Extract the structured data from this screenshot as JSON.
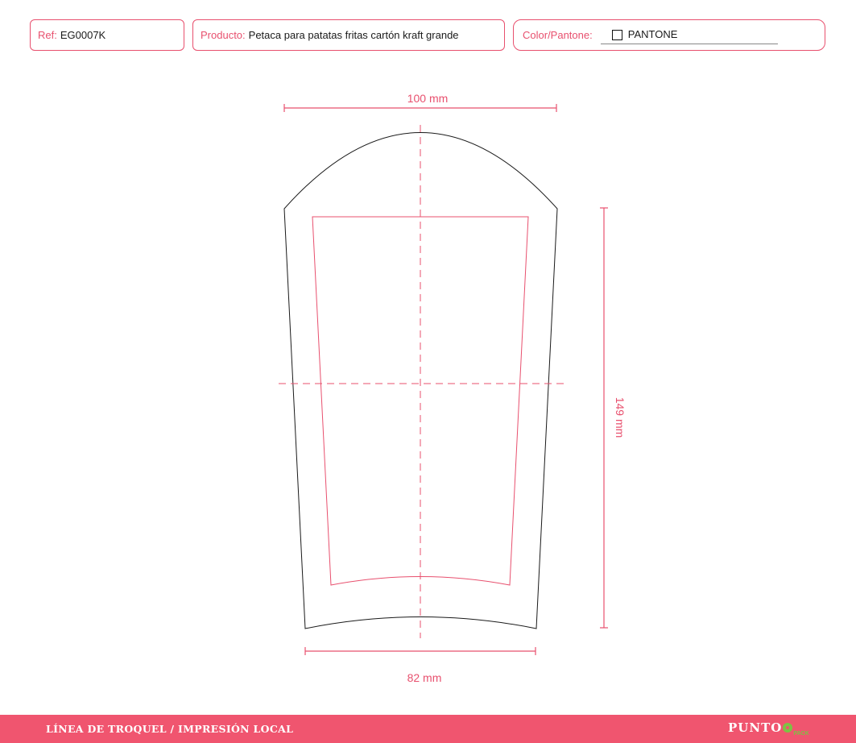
{
  "header": {
    "ref_label": "Ref:",
    "ref_value": "EG0007K",
    "product_label": "Producto:",
    "product_value": "Petaca para patatas fritas cartón kraft grande",
    "color_label": "Color/Pantone:",
    "pantone_text": "PANTONE"
  },
  "dimensions": {
    "top_width": "100 mm",
    "bottom_width": "82 mm",
    "height": "149 mm"
  },
  "footer": {
    "title": "LÍNEA DE TROQUEL / IMPRESIÓN LOCAL",
    "logo_word": "PUNTO",
    "logo_sub": "PACK"
  },
  "colors": {
    "accent": "#e8506e",
    "footer_bg": "#f0556f",
    "logo_green": "#7cc243",
    "die_line": "#1a1a1a"
  }
}
